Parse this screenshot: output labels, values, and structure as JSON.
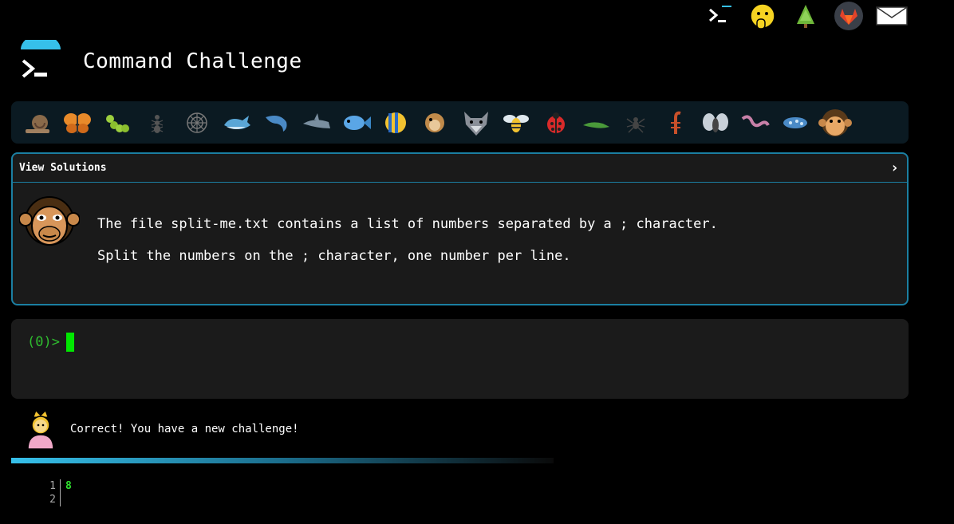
{
  "app": {
    "title": "Command Challenge"
  },
  "topnav": {
    "icons": [
      "terminal-icon",
      "shushing-face-icon",
      "tree-icon",
      "gitlab-icon",
      "envelope-icon"
    ]
  },
  "animals": [
    "snail",
    "butterfly",
    "caterpillar",
    "ant",
    "spider-web",
    "whale",
    "dolphin",
    "shark",
    "fish",
    "tropical-fish",
    "blowfish",
    "wolf",
    "bee",
    "ladybug",
    "lizard",
    "spider",
    "scorpion",
    "fly",
    "worm",
    "microbe",
    "monkey"
  ],
  "challenge": {
    "header": "View Solutions",
    "chevron": "›",
    "line1": "The file split-me.txt contains a list of numbers separated by a ; character.",
    "line2": "Split the numbers on the ; character, one number per line."
  },
  "terminal": {
    "prompt": "(0)>"
  },
  "result": {
    "message": "Correct! You have a new challenge!"
  },
  "output": {
    "line_numbers": [
      "1",
      "2"
    ],
    "lines": [
      "8",
      ""
    ]
  },
  "colors": {
    "accent": "#1b7fa2",
    "prompt": "#2fbd2f",
    "cursor": "#00e600",
    "output": "#2fe02f"
  }
}
